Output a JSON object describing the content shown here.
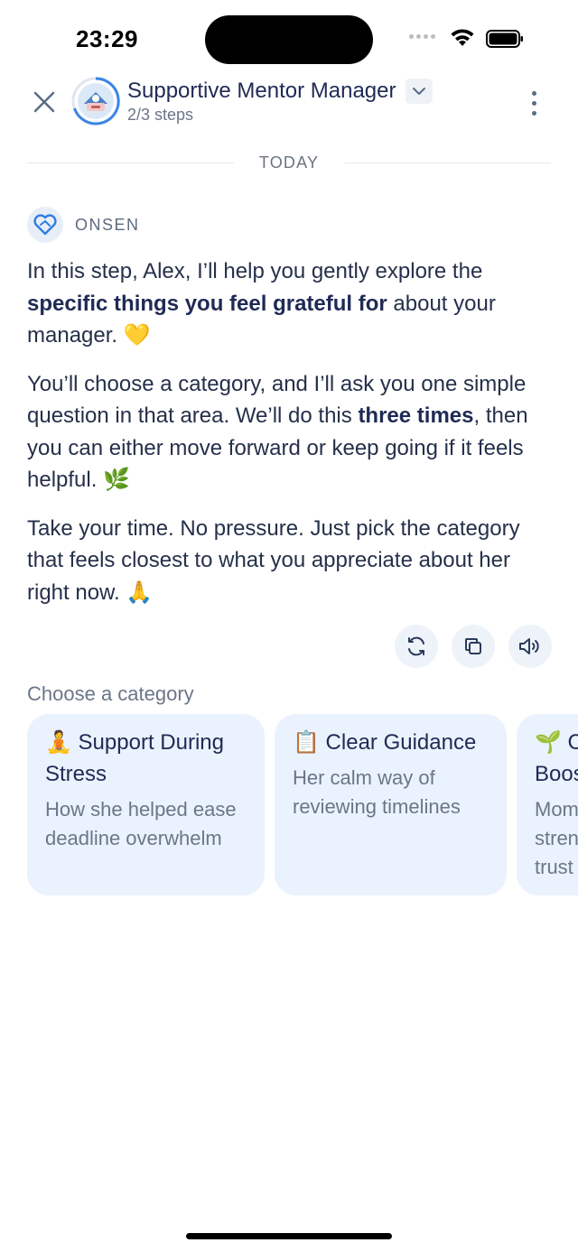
{
  "status_bar": {
    "time": "23:29"
  },
  "header": {
    "title": "Supportive Mentor Manager",
    "steps": "2/3 steps"
  },
  "chat": {
    "date_label": "TODAY",
    "sender": "ONSEN",
    "message": {
      "p1_a": "In this step, Alex, I’ll help you gently explore the ",
      "p1_b": "specific things you feel grateful for",
      "p1_c": " about your manager. 💛",
      "p2_a": "You’ll choose a category, and I’ll ask you one simple question in that area. We’ll do this ",
      "p2_b": "three times",
      "p2_c": ", then you can either move forward or keep going if it feels helpful. 🌿",
      "p3": "Take your time. No pressure. Just pick the category that feels closest to what you appreciate about her right now. 🙏"
    }
  },
  "categories": {
    "label": "Choose a category",
    "cards": [
      {
        "title": "🧘 Support During Stress",
        "desc": "How she helped ease deadline overwhelm"
      },
      {
        "title": "📋 Clear Guidance",
        "desc": "Her calm way of reviewing timelines"
      },
      {
        "title": "🌱 Confidence Boost",
        "desc": "Moments that strengthened self-trust"
      }
    ]
  },
  "icons": {
    "close": "close-icon",
    "chevron": "chevron-down-icon",
    "more": "more-vertical-icon",
    "regenerate": "refresh-icon",
    "copy": "copy-icon",
    "speaker": "speaker-icon"
  },
  "colors": {
    "accent": "#2f7de1",
    "card_bg": "#eaf2fd",
    "text_primary": "#1f2a55",
    "text_muted": "#6b7688"
  }
}
